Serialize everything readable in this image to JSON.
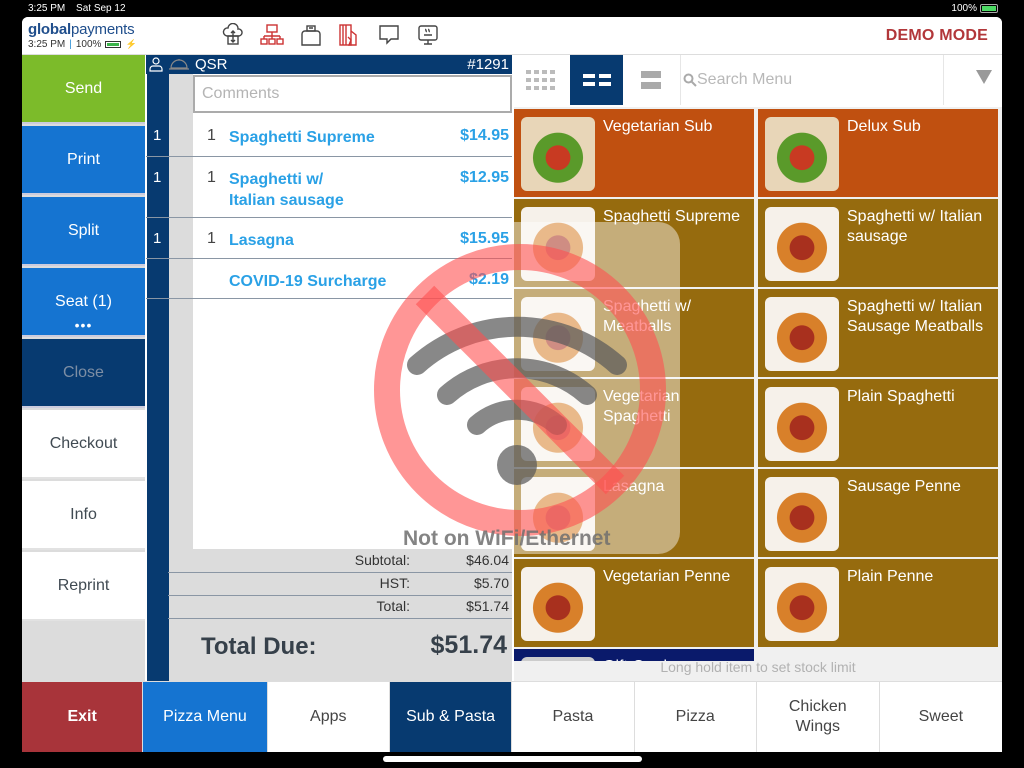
{
  "status_bar": {
    "time": "3:25 PM",
    "date": "Sat Sep 12",
    "battery": "100%"
  },
  "header": {
    "brand_bold": "global",
    "brand_light": "payments",
    "time": "3:25 PM",
    "battery": "100%",
    "icons": [
      "cloud-sync-icon",
      "network-icon",
      "printer-icon",
      "card-reader-icon",
      "chat-icon",
      "kitchen-display-icon"
    ],
    "mode": "DEMO MODE"
  },
  "left_buttons": {
    "send": "Send",
    "print": "Print",
    "split": "Split",
    "seat": "Seat (1)",
    "seat_more": "•••",
    "close": "Close",
    "checkout": "Checkout",
    "info": "Info",
    "reprint": "Reprint"
  },
  "order": {
    "type": "QSR",
    "number": "#1291",
    "comments_placeholder": "Comments",
    "items": [
      {
        "seat": "1",
        "qty": "1",
        "name": "Spaghetti Supreme",
        "price": "$14.95"
      },
      {
        "seat": "1",
        "qty": "1",
        "name_line1": "Spaghetti w/",
        "name_line2": "Italian sausage",
        "price": "$12.95"
      },
      {
        "seat": "1",
        "qty": "1",
        "name": "Lasagna",
        "price": "$15.95"
      },
      {
        "name": "COVID-19 Surcharge",
        "price": "$2.19"
      }
    ],
    "subtotal_label": "Subtotal:",
    "subtotal": "$46.04",
    "tax_label": "HST:",
    "tax": "$5.70",
    "total_label": "Total:",
    "total": "$51.74",
    "due_label": "Total Due:",
    "due": "$51.74"
  },
  "menu": {
    "search_placeholder": "Search Menu",
    "view_modes": [
      "grid-small-view",
      "grid-two-column-view",
      "list-view"
    ],
    "active_view": "grid-two-column-view",
    "items": [
      {
        "name": "Vegetarian Sub",
        "category": "sub"
      },
      {
        "name": "Delux Sub",
        "category": "sub"
      },
      {
        "name": "Spaghetti Supreme",
        "category": "pasta"
      },
      {
        "name": "Spaghetti w/ Italian sausage",
        "category": "pasta"
      },
      {
        "name": "Spaghetti w/ Meatballs",
        "category": "pasta"
      },
      {
        "name": "Spaghetti w/ Italian Sausage Meatballs",
        "category": "pasta"
      },
      {
        "name": "Vegetarian Spaghetti",
        "category": "pasta"
      },
      {
        "name": "Plain Spaghetti",
        "category": "pasta"
      },
      {
        "name": "Lasagna",
        "category": "pasta"
      },
      {
        "name": "Sausage Penne",
        "category": "pasta"
      },
      {
        "name": "Vegetarian Penne",
        "category": "pasta"
      },
      {
        "name": "Plain Penne",
        "category": "pasta"
      },
      {
        "name": "Gift Card",
        "category": "gift"
      }
    ],
    "hint": "Long hold item to set stock limit"
  },
  "tabs": [
    {
      "label": "Exit"
    },
    {
      "label": "Pizza Menu"
    },
    {
      "label": "Apps"
    },
    {
      "label": "Sub & Pasta",
      "active": true
    },
    {
      "label": "Pasta"
    },
    {
      "label": "Pizza"
    },
    {
      "label": "Chicken Wings"
    },
    {
      "label": "Sweet"
    }
  ],
  "overlay": {
    "message": "Not on WiFi/Ethernet"
  },
  "colors": {
    "send": "#7cbb2a",
    "primary_blue": "#1574d1",
    "navy": "#073a70",
    "exit": "#a8343a",
    "demo": "#b2373a",
    "sub_tile": "#c05010",
    "pasta_tile": "#966b0e",
    "price": "#2aa1e6"
  }
}
